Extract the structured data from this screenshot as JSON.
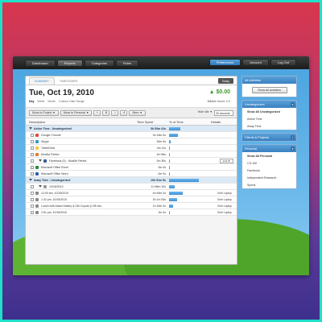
{
  "nav": {
    "left": [
      "Dashboard",
      "Reports",
      "Categories",
      "Rules"
    ],
    "right": [
      "Preferences",
      "Account",
      "Log Out"
    ]
  },
  "tabs": [
    "SUMMARY",
    "TIMESTAMPS"
  ],
  "today_label": "Today",
  "date": "Tue, Oct 19, 2010",
  "views": [
    "Day",
    "Week",
    "Month",
    "Custom Date Range"
  ],
  "earnings": "▲ $0.00",
  "billable": "Billable Hours: 0.0",
  "toolbar": {
    "move_project": "Move to Project ▼",
    "move_personal": "Move to Personal ▼",
    "b1": "+",
    "b2": "B",
    "b3": "I",
    "b4": "↺",
    "more": "More ▼",
    "hide_label": "Hide Idle ▼",
    "seconds": "30 seconds"
  },
  "columns": {
    "description": "Description",
    "time": "Time Spent",
    "percent": "% of Time",
    "details": "Details"
  },
  "rows": [
    {
      "type": "group",
      "desc": "Active Time - Uncategorized",
      "time": "3h 54m 41s",
      "pct": 0.26
    },
    {
      "type": "item",
      "desc": "Google Chrome",
      "time": "3h 16m 0s",
      "pct": 0.22,
      "color": "#e04a3a"
    },
    {
      "type": "item",
      "desc": "Skype",
      "time": "30m 9s",
      "pct": 0.04,
      "color": "#2a9ad8"
    },
    {
      "type": "item",
      "desc": "TweetDeck",
      "time": "4m 11s",
      "pct": 0.01,
      "color": "#f2c83a"
    },
    {
      "type": "item",
      "desc": "Mozilla Firefox",
      "time": "2m 56s",
      "pct": 0.01,
      "color": "#e07a2a"
    },
    {
      "type": "item",
      "desc": "Facebook (3) - Mozilla Firefox",
      "time": "2m 30s",
      "pct": 0.005,
      "color": "#3a5a9a",
      "link": "Link ▼",
      "arrow": true
    },
    {
      "type": "item",
      "desc": "Microsoft Office Excel",
      "time": "0m 0s",
      "pct": 0.0,
      "color": "#2a8a3a"
    },
    {
      "type": "item",
      "desc": "Microsoft Office Word",
      "time": "0m 0s",
      "pct": 0.0,
      "color": "#2a5ab8"
    },
    {
      "type": "group",
      "desc": "Away Time - Uncategorized",
      "time": "10h 51m 5s",
      "pct": 0.72
    },
    {
      "type": "item",
      "desc": "10/18/2010",
      "time": "1h 56m 10s",
      "pct": 0.13,
      "color": "#999",
      "arrow": true
    },
    {
      "type": "item",
      "desc": "12:00 am, 10/18/2010",
      "time": "4h 45m 0s",
      "pct": 0.32,
      "color": "#888",
      "details": "Gnbt Laptop"
    },
    {
      "type": "item",
      "desc": "1:32 pm, 10/18/2010",
      "time": "3h 1m 53s",
      "pct": 0.2,
      "color": "#888",
      "details": "Gnbt Laptop"
    },
    {
      "type": "item",
      "desc": "Lunch with Adam Kalsey & Obi Coyote (1:55 am,",
      "time": "1h 30m 0s",
      "pct": 0.1,
      "color": "#888",
      "details": "Gnbt Laptop"
    },
    {
      "type": "item",
      "desc": "2:51 pm, 10/18/2010",
      "time": "2m 0s",
      "pct": 0.01,
      "color": "#888",
      "details": "Gnbt Laptop"
    }
  ],
  "sidebar": {
    "all": {
      "title": "All Activities",
      "button": "Show All Activities"
    },
    "uncat": {
      "title": "Uncategorized",
      "items": [
        "Show All Uncategorized",
        "Active Time",
        "Away Time"
      ]
    },
    "clients": {
      "title": "Clients & Projects"
    },
    "personal": {
      "title": "Personal",
      "items": [
        "Show All Personal",
        "CS-100",
        "Facebook",
        "Independent Research",
        "Sports"
      ]
    }
  },
  "colors": {
    "accent": "#3a80c0",
    "earn": "#3a9a2a",
    "frame": "#1fe0c8"
  }
}
